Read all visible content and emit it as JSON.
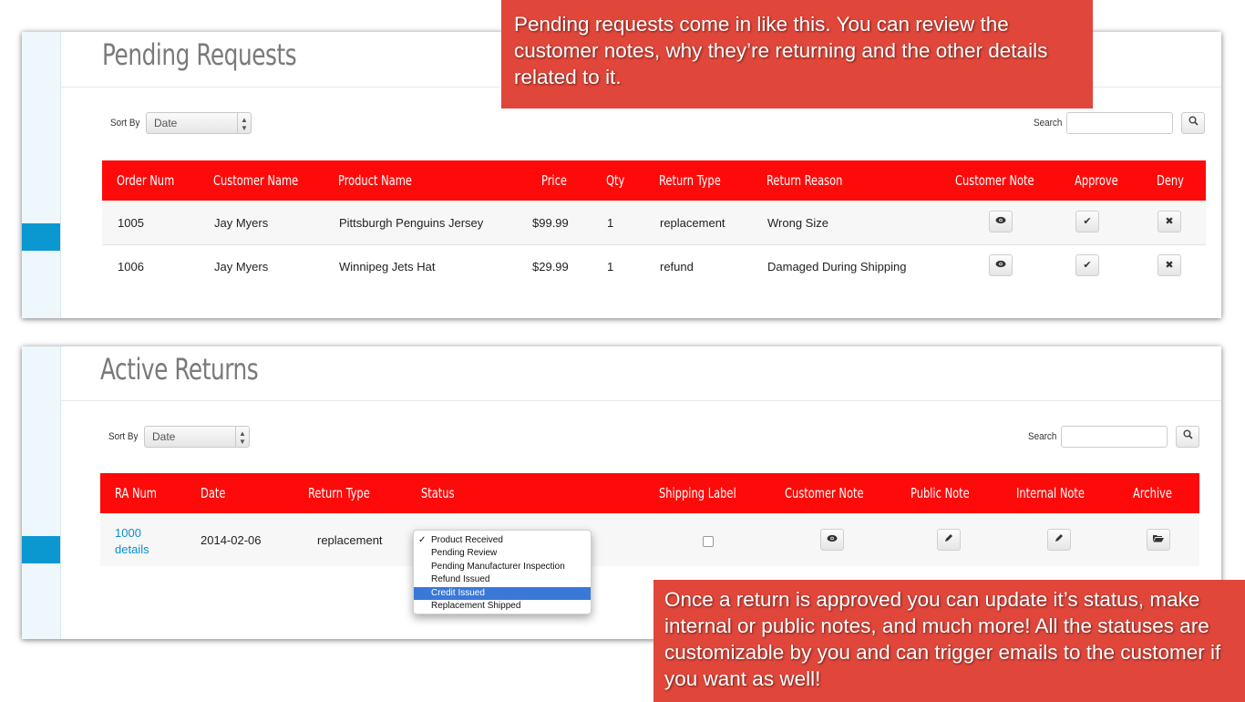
{
  "pending": {
    "title": "Pending Requests",
    "sort_label": "Sort By",
    "sort_value": "Date",
    "search_label": "Search",
    "columns": [
      "Order Num",
      "Customer Name",
      "Product Name",
      "Price",
      "Qty",
      "Return Type",
      "Return Reason",
      "Customer Note",
      "Approve",
      "Deny"
    ],
    "rows": [
      {
        "order_num": "1005",
        "customer": "Jay Myers",
        "product": "Pittsburgh Penguins Jersey",
        "price": "$99.99",
        "qty": "1",
        "return_type": "replacement",
        "reason": "Wrong Size"
      },
      {
        "order_num": "1006",
        "customer": "Jay Myers",
        "product": "Winnipeg Jets Hat",
        "price": "$29.99",
        "qty": "1",
        "return_type": "refund",
        "reason": "Damaged During Shipping"
      }
    ]
  },
  "active": {
    "title": "Active Returns",
    "sort_label": "Sort By",
    "sort_value": "Date",
    "search_label": "Search",
    "columns": [
      "RA Num",
      "Date",
      "Return Type",
      "Status",
      "Shipping Label",
      "Customer Note",
      "Public Note",
      "Internal Note",
      "Archive"
    ],
    "rows": [
      {
        "ra_num": "1000",
        "details_link": "details",
        "date": "2014-02-06",
        "return_type": "replacement",
        "status": "Product Received"
      }
    ],
    "status_options": [
      "Product Received",
      "Pending Review",
      "Pending Manufacturer Inspection",
      "Refund Issued",
      "Credit Issued",
      "Replacement Shipped"
    ],
    "status_checked": "Product Received",
    "status_highlighted": "Credit Issued"
  },
  "callouts": {
    "top": "Pending requests come in like this. You can review the customer notes, why they’re returning and the other details related to it.",
    "bottom": "Once a return is approved you can update it’s status, make internal or public notes, and much more! All the statuses are customizable by you and can trigger emails to the customer if you want as well!"
  },
  "icons": {
    "view": "eye-icon",
    "approve": "check-icon",
    "deny": "close-icon",
    "edit": "pencil-icon",
    "archive": "folder-open-icon",
    "search": "search-icon"
  },
  "colors": {
    "table_header": "#ff0a0a",
    "callout": "#e0463a",
    "accent": "#0b97cf",
    "link": "#0b8fd1",
    "dropdown_highlight": "#3a78d8"
  }
}
